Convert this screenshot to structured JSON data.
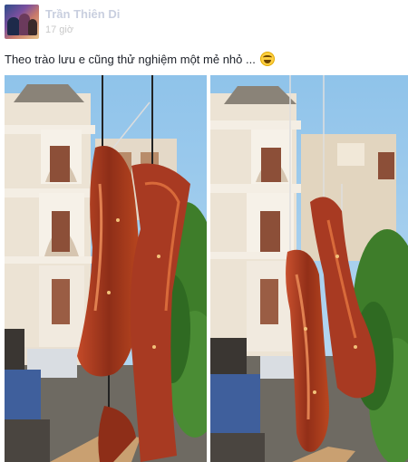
{
  "post": {
    "author_name": "Trần Thiên Di",
    "timestamp": "17 giờ",
    "caption": "Theo trào lưu e cũng thử nghiệm một mẻ nhỏ ...",
    "emoji_icon": "laughing-emoji-icon"
  },
  "photos": [
    {
      "name": "photo-dried-meat-left"
    },
    {
      "name": "photo-dried-meat-right"
    }
  ],
  "colors": {
    "sky": "#8fc3ea",
    "meat": "#a83a22",
    "building": "#e9dfd1",
    "foliage": "#3e7d2a"
  }
}
